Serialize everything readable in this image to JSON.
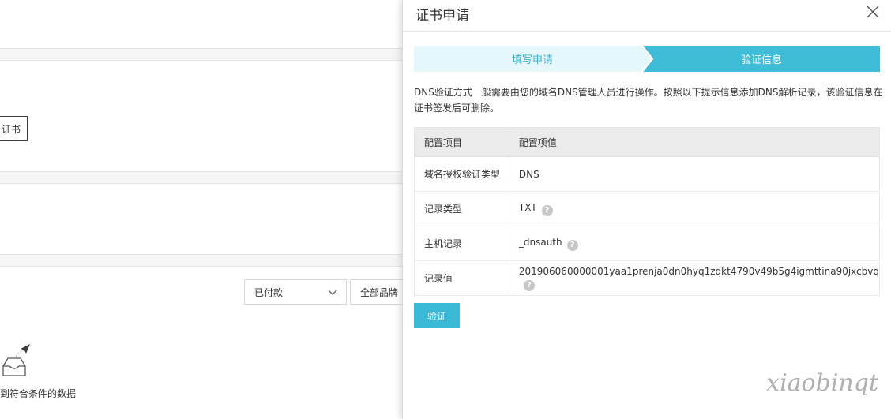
{
  "background": {
    "button_fragment": "证书",
    "status_select": "已付款",
    "brand_select": "全部品牌",
    "empty_text": "到符合条件的数据"
  },
  "drawer": {
    "title": "证书申请",
    "steps": [
      "填写申请",
      "验证信息"
    ],
    "active_step": 2,
    "description": "DNS验证方式一般需要由您的域名DNS管理人员进行操作。按照以下提示信息添加DNS解析记录，该验证信息在证书签发后可删除。",
    "table": {
      "headers": [
        "配置项目",
        "配置项值"
      ],
      "rows": [
        {
          "item": "域名授权验证类型",
          "value": "DNS",
          "help": false
        },
        {
          "item": "记录类型",
          "value": "TXT",
          "help": true
        },
        {
          "item": "主机记录",
          "value": "_dnsauth",
          "help": true
        },
        {
          "item": "记录值",
          "value": "201906060000001yaa1prenja0dn0hyq1zdkt4790v49b5g4igmttina90jxcbvq",
          "help": true
        }
      ]
    },
    "verify_button": "验证",
    "help_glyph": "?"
  },
  "watermark": "xiaobinqt",
  "colors": {
    "accent": "#39b9d6",
    "step_inactive_bg": "#e5f7fb",
    "step_inactive_text": "#39b2c9"
  }
}
